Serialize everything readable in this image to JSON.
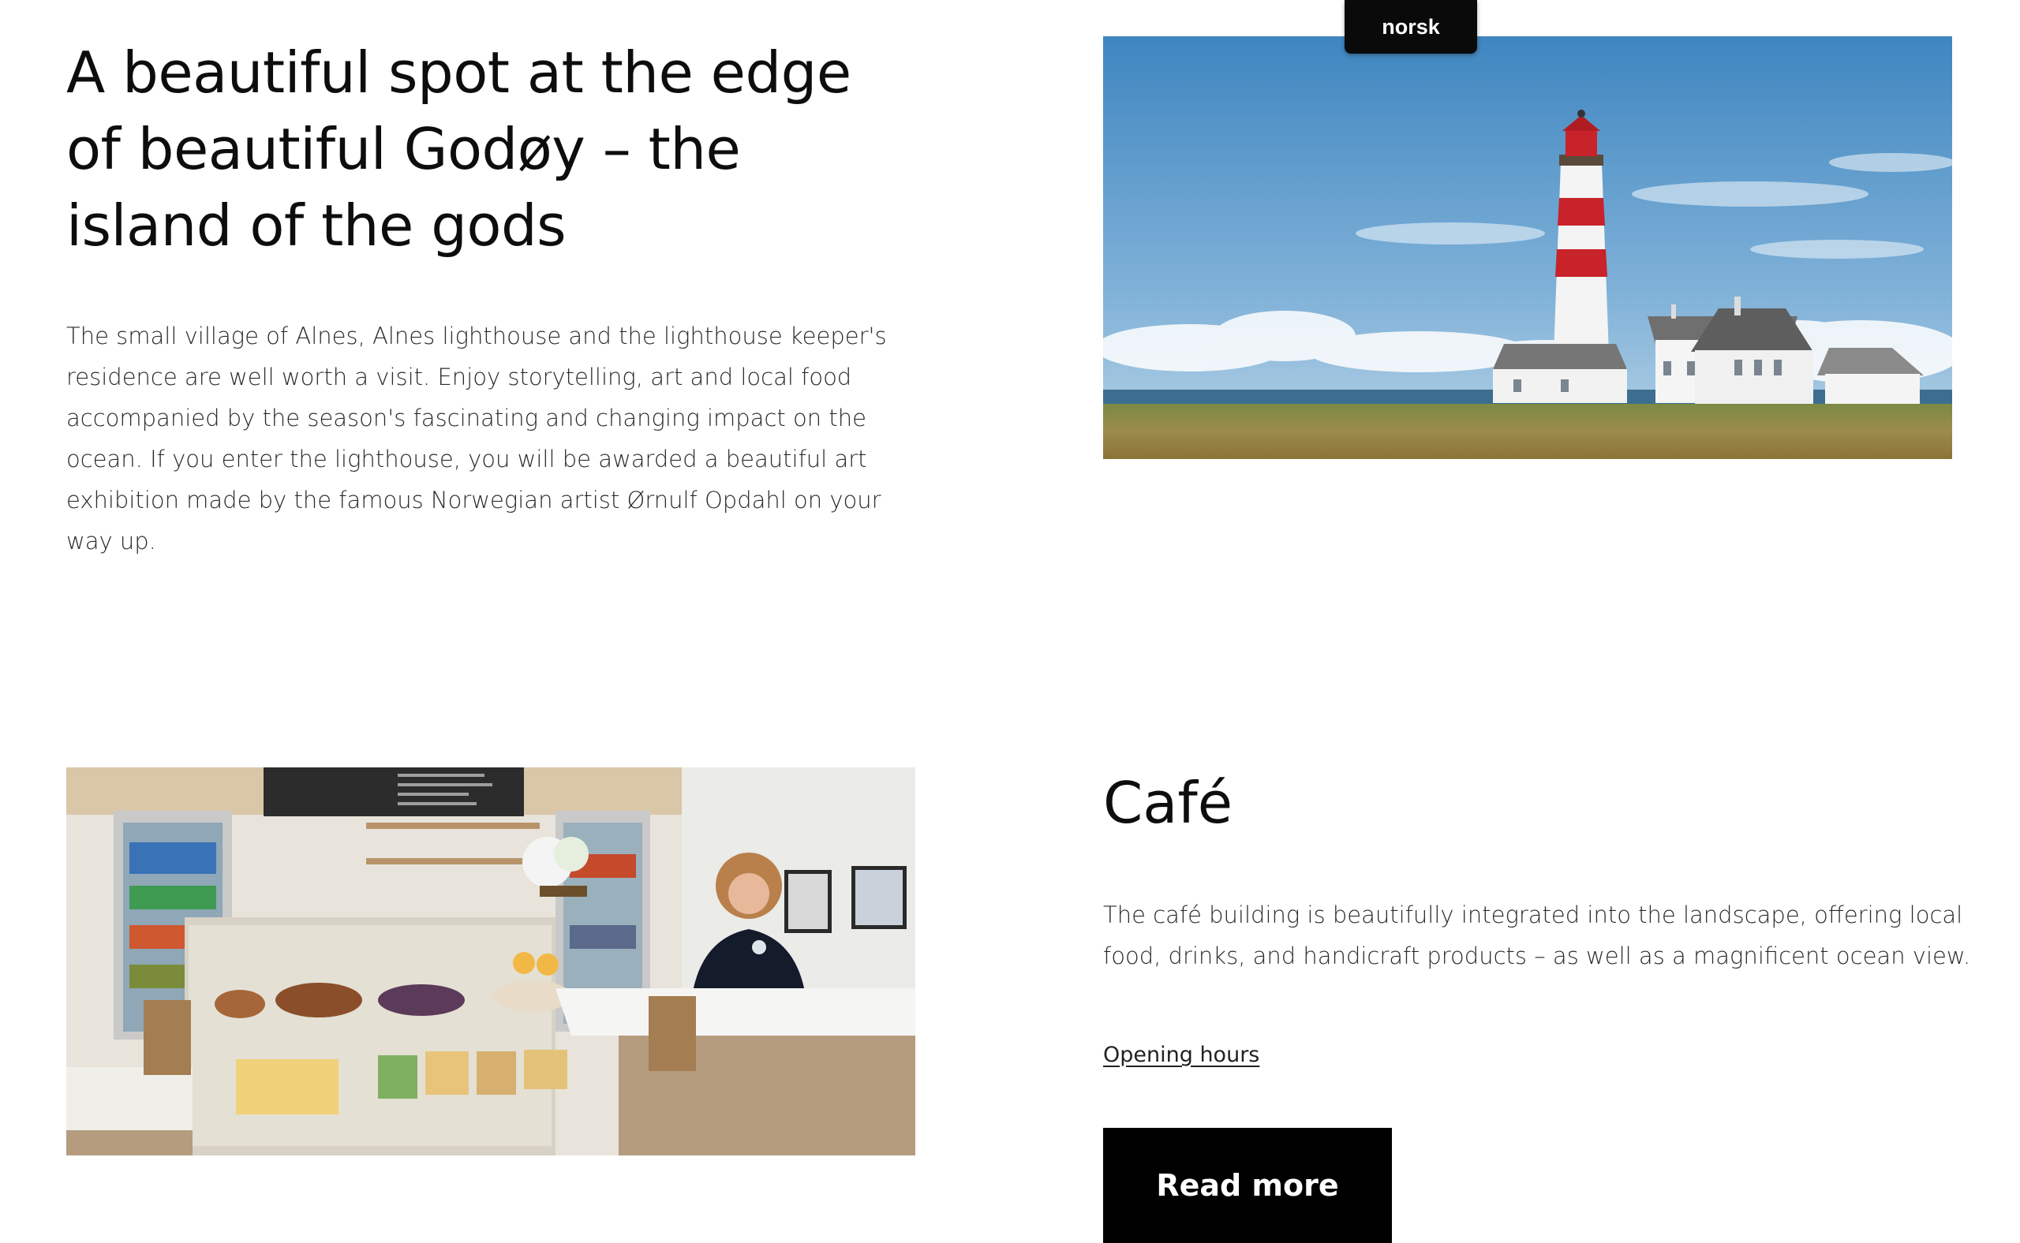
{
  "language_switch": {
    "label": "norsk"
  },
  "intro": {
    "title": "A beautiful spot at the edge of beautiful Godøy – the island of the gods",
    "text": "The small village of Alnes, Alnes lighthouse and the lighthouse keeper's residence are well worth a visit. Enjoy storytelling, art and local food accompanied by the season's fascinating and changing impact on the ocean. If you enter the lighthouse, you will be awarded a beautiful art exhibition made by the famous Norwegian artist Ørnulf Opdahl on your way up."
  },
  "cafe": {
    "title": "Café",
    "text": "The café building is beautifully integrated into the landscape, offering local food, drinks, and handicraft products – as well as a magnificent ocean view.",
    "opening_hours_link": "Opening hours",
    "read_more_button": "Read more"
  },
  "colors": {
    "badge_background": "#0a0a0a",
    "button_background": "#000000",
    "text": "#111111",
    "lighthouse_red": "#c8222a"
  }
}
